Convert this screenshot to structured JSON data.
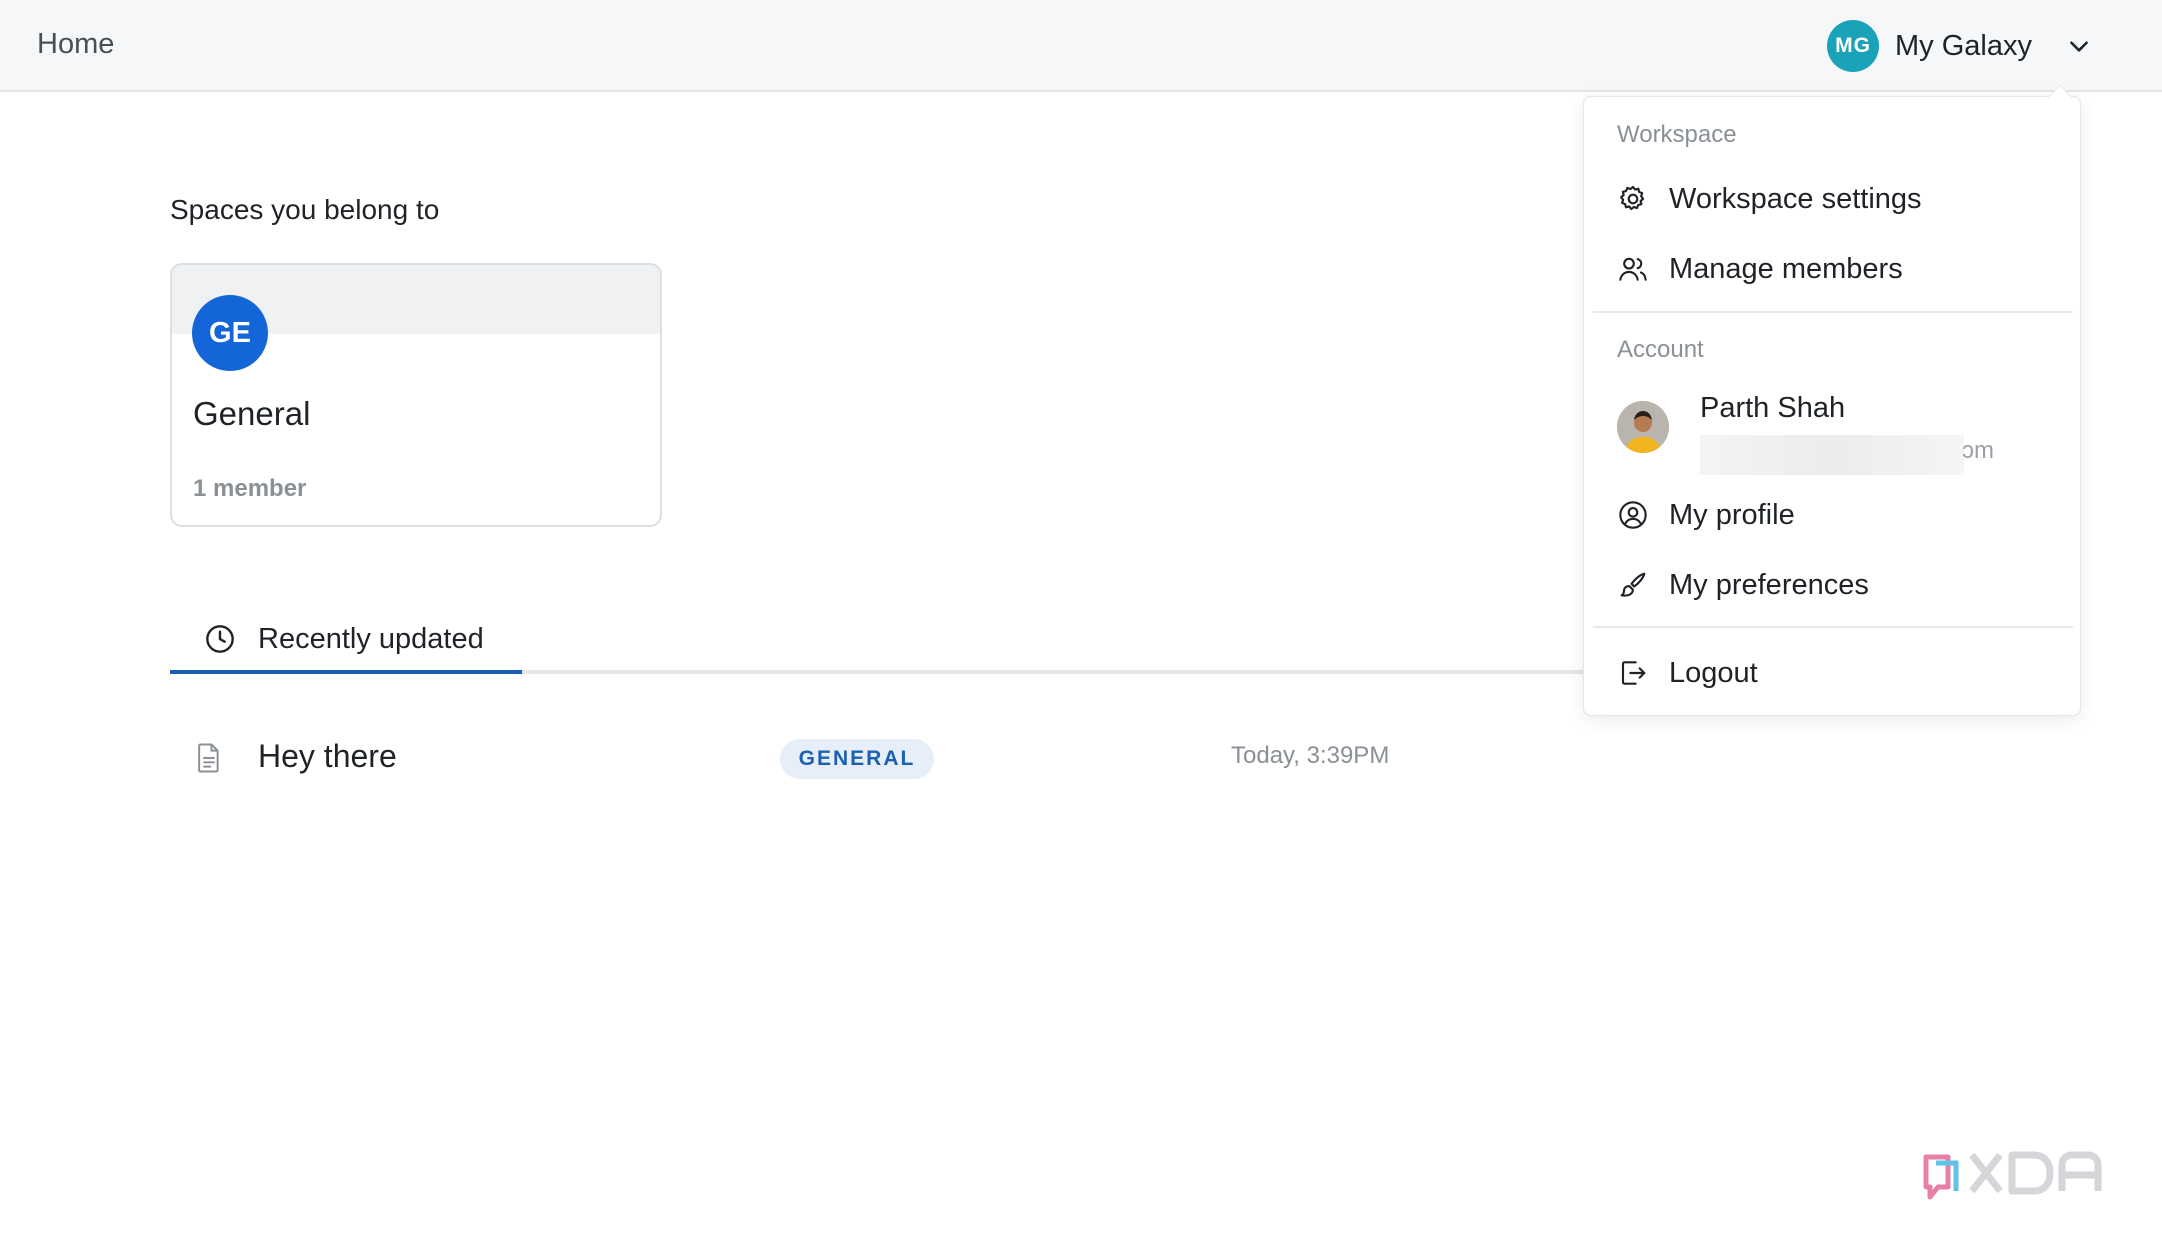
{
  "topbar": {
    "home_label": "Home",
    "workspace": {
      "initials": "MG",
      "name": "My Galaxy",
      "avatar_color": "#1aa3b8"
    }
  },
  "main": {
    "spaces_title": "Spaces you belong to",
    "spaces": [
      {
        "initials": "GE",
        "name": "General",
        "members": "1 member",
        "avatar_color": "#1466d8"
      }
    ],
    "tabs": [
      {
        "label": "Recently updated",
        "icon": "clock-icon",
        "active": true
      }
    ],
    "recent_docs": [
      {
        "title": "Hey there",
        "space_badge": "GENERAL",
        "updated": "Today, 3:39PM",
        "icon": "document-icon"
      }
    ]
  },
  "dropdown": {
    "workspace_heading": "Workspace",
    "workspace_items": [
      {
        "label": "Workspace settings",
        "icon": "gear-icon"
      },
      {
        "label": "Manage members",
        "icon": "users-icon"
      }
    ],
    "account_heading": "Account",
    "user": {
      "name": "Parth Shah",
      "email_visible_tail": "ɔm"
    },
    "account_items": [
      {
        "label": "My profile",
        "icon": "user-circle-icon"
      },
      {
        "label": "My preferences",
        "icon": "brush-icon"
      }
    ],
    "logout": {
      "label": "Logout",
      "icon": "logout-icon"
    }
  },
  "colors": {
    "accent": "#1a5fb4",
    "badge_bg": "#e6eefa",
    "badge_text": "#1d5fb0"
  }
}
